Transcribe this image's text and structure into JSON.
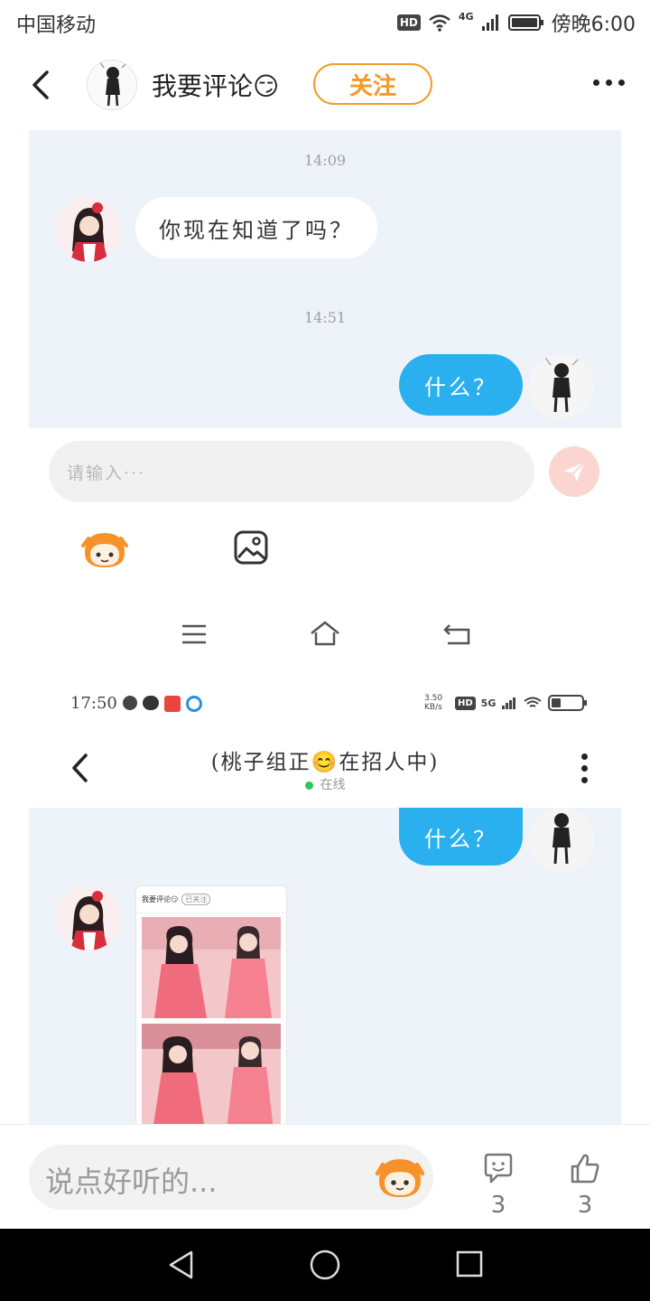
{
  "status_bar": {
    "carrier": "中国移动",
    "hd": "HD",
    "network": "4G",
    "time": "傍晚6:00"
  },
  "post_header": {
    "author_name": "我要评论😏",
    "follow_label": "关注"
  },
  "screenshot_one": {
    "messages": [
      {
        "timestamp": "14:09",
        "side": "left",
        "text": "你现在知道了吗？"
      },
      {
        "timestamp": "14:51",
        "side": "right",
        "text": "什么？"
      }
    ],
    "input_placeholder": "请输入···"
  },
  "screenshot_two": {
    "status_time": "17:50",
    "net_speed": "3.50 KB/s",
    "hd": "HD",
    "network": "5G",
    "chat_title": "(桃子组正😊在招人中)",
    "online_status": "在线",
    "messages": [
      {
        "side": "right",
        "text": "什么？"
      },
      {
        "side": "left",
        "type": "image"
      }
    ],
    "embedded_shot": {
      "title": "我要评论😏",
      "follow_state": "已关注"
    }
  },
  "comment_bar": {
    "placeholder": "说点好听的...",
    "comment_count": "3",
    "like_count": "3"
  },
  "colors": {
    "follow_accent": "#f39a27",
    "bubble_blue": "#2ab0ee",
    "chat_background": "#eef3fa",
    "online_green": "#32c35a"
  },
  "icons": [
    "back-icon",
    "more-icon",
    "send-icon",
    "emoji-mascot-icon",
    "image-icon",
    "menu-icon",
    "home-icon",
    "return-icon",
    "comment-icon",
    "like-icon"
  ]
}
